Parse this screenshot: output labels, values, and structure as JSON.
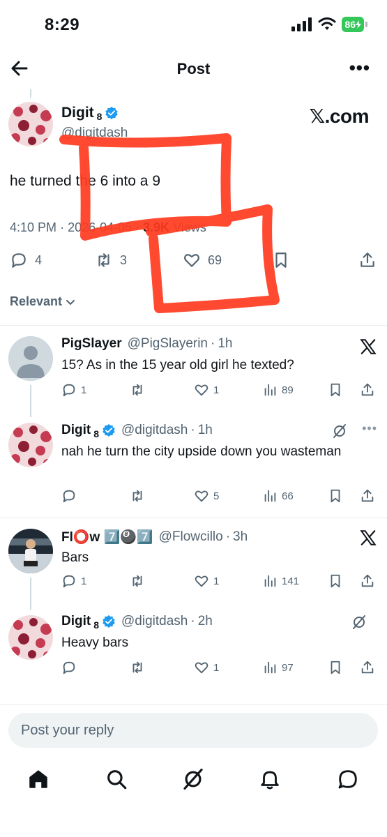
{
  "status_bar": {
    "time": "8:29",
    "battery": "86"
  },
  "nav": {
    "title": "Post"
  },
  "main_post": {
    "author_name": "Digit",
    "author_suffix": "8",
    "handle": "@digitdash",
    "watermark": "𝕏.com",
    "text": "he turned the 6 into a 9",
    "time": "4:10 PM",
    "date": "2026-04-05",
    "views_count": "3.9K",
    "views_label": "Views",
    "replies": "4",
    "reposts": "3",
    "likes": "69"
  },
  "sort": {
    "label": "Relevant"
  },
  "replies": [
    {
      "name": "PigSlayer",
      "handle": "@PigSlayerin",
      "time": "1h",
      "text": "15? As in the 15 year old girl he texted?",
      "reply_count": "1",
      "like_count": "1",
      "view_count": "89"
    },
    {
      "name": "Digit",
      "name_suffix": "8",
      "handle": "@digitdash",
      "time": "1h",
      "text": "nah he turn the city upside down you wasteman",
      "like_count": "5",
      "view_count": "66"
    },
    {
      "name": "Fl⭕w 7️⃣🎱7️⃣",
      "handle": "@Flowcillo",
      "time": "3h",
      "text": "Bars",
      "reply_count": "1",
      "like_count": "1",
      "view_count": "141"
    },
    {
      "name": "Digit",
      "name_suffix": "8",
      "handle": "@digitdash",
      "time": "2h",
      "text": "Heavy bars",
      "like_count": "1",
      "view_count": "97"
    }
  ],
  "reply_input": {
    "placeholder": "Post your reply"
  },
  "icons": {
    "back": "arrow-left-icon",
    "more": "more-icon",
    "verified": "verified-badge-icon",
    "reply": "reply-icon",
    "repost": "repost-icon",
    "like": "heart-icon",
    "views": "views-icon",
    "bookmark": "bookmark-icon",
    "share": "share-icon",
    "x_logo": "x-logo-icon",
    "grok": "grok-icon",
    "home": "home-icon",
    "search": "search-icon",
    "notifications": "bell-icon",
    "messages": "message-icon"
  },
  "colors": {
    "accent": "#1d9bf0",
    "annotation": "#ff3b1f",
    "muted": "#536471"
  }
}
